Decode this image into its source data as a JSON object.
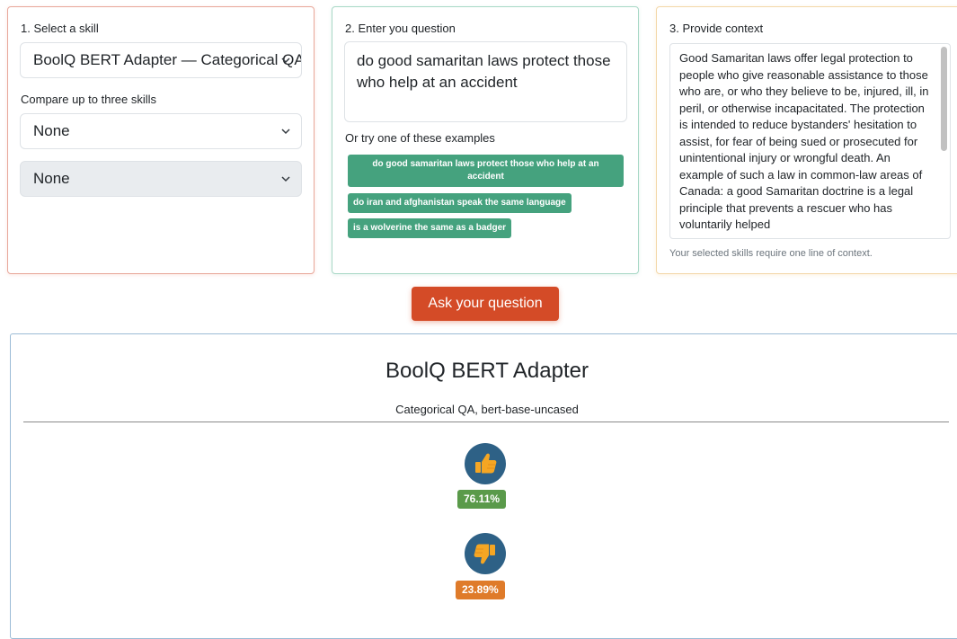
{
  "skill_panel": {
    "label": "1. Select a skill",
    "selected_skill": "BoolQ BERT Adapter — Categorical QA",
    "compare_label": "Compare up to three skills",
    "compare_1": "None",
    "compare_2": "None"
  },
  "question_panel": {
    "label": "2. Enter you question",
    "question_value": "do good samaritan laws protect those who help at an accident",
    "examples_label": "Or try one of these examples",
    "examples": [
      "do good samaritan laws protect those who help at an accident",
      "do iran and afghanistan speak the same language",
      "is a wolverine the same as a badger"
    ]
  },
  "context_panel": {
    "label": "3. Provide context",
    "context_text": "Good Samaritan laws offer legal protection to people who give reasonable assistance to those who are, or who they believe to be, injured, ill, in peril, or otherwise incapacitated. The protection is intended to reduce bystanders' hesitation to assist, for fear of being sued or prosecuted for unintentional injury or wrongful death. An example of such a law in common-law areas of Canada: a good Samaritan doctrine is a legal principle that prevents a rescuer who has voluntarily helped",
    "hint": "Your selected skills require one line of context."
  },
  "ask_button": "Ask your question",
  "result": {
    "title": "BoolQ BERT Adapter",
    "subtitle": "Categorical QA, bert-base-uncased",
    "answers": [
      {
        "icon": "thumbs-up-icon",
        "percent_label": "76.11%",
        "probability": 0.7611,
        "color": "#5a9a4a"
      },
      {
        "icon": "thumbs-down-icon",
        "percent_label": "23.89%",
        "probability": 0.2389,
        "color": "#df7b2a"
      }
    ]
  },
  "colors": {
    "ask_button": "#d44b27",
    "example_button": "#45a27e",
    "icon_circle": "#2e6186",
    "thumb_fill": "#f5a623"
  }
}
